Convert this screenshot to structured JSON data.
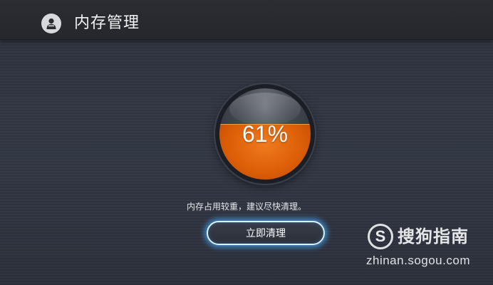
{
  "header": {
    "title": "内存管理",
    "icon": "broom-user-icon"
  },
  "memory_gauge": {
    "percent_label": "61%",
    "used_fraction": 0.61,
    "fill_color": "#e0640c"
  },
  "message": "内存占用较重，建议尽快清理。",
  "actions": {
    "clean_label": "立即清理"
  },
  "watermark": {
    "logo_glyph": "S",
    "name": "搜狗指南",
    "url": "zhinan.sogou.com"
  },
  "colors": {
    "accent_glow": "#46aaff",
    "background": "#30343f"
  }
}
